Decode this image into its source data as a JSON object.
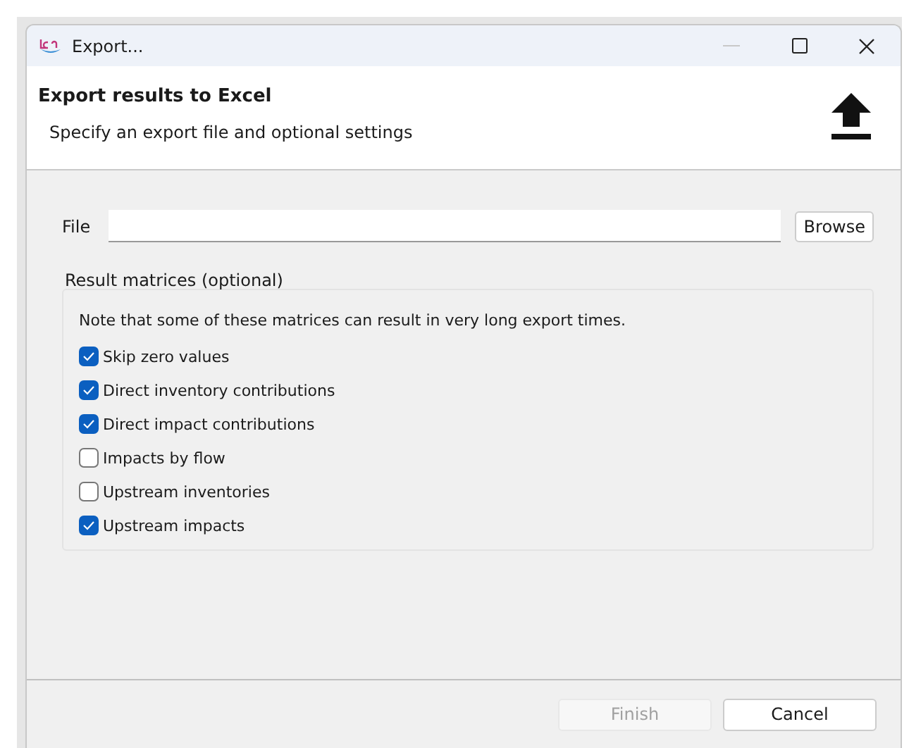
{
  "window": {
    "title": "Export..."
  },
  "header": {
    "title": "Export results to Excel",
    "subtitle": "Specify an export file and optional settings"
  },
  "file": {
    "label": "File",
    "browse": "Browse"
  },
  "group": {
    "title": "Result matrices (optional)",
    "note": "Note that some of these matrices can result in very long export times.",
    "options": [
      {
        "label": "Skip zero values",
        "checked": true
      },
      {
        "label": "Direct inventory contributions",
        "checked": true
      },
      {
        "label": "Direct impact contributions",
        "checked": true
      },
      {
        "label": "Impacts by flow",
        "checked": false
      },
      {
        "label": "Upstream inventories",
        "checked": false
      },
      {
        "label": "Upstream impacts",
        "checked": true
      }
    ]
  },
  "buttons": [
    {
      "label": "Finish",
      "disabled": true
    },
    {
      "label": "Cancel",
      "disabled": false
    }
  ]
}
